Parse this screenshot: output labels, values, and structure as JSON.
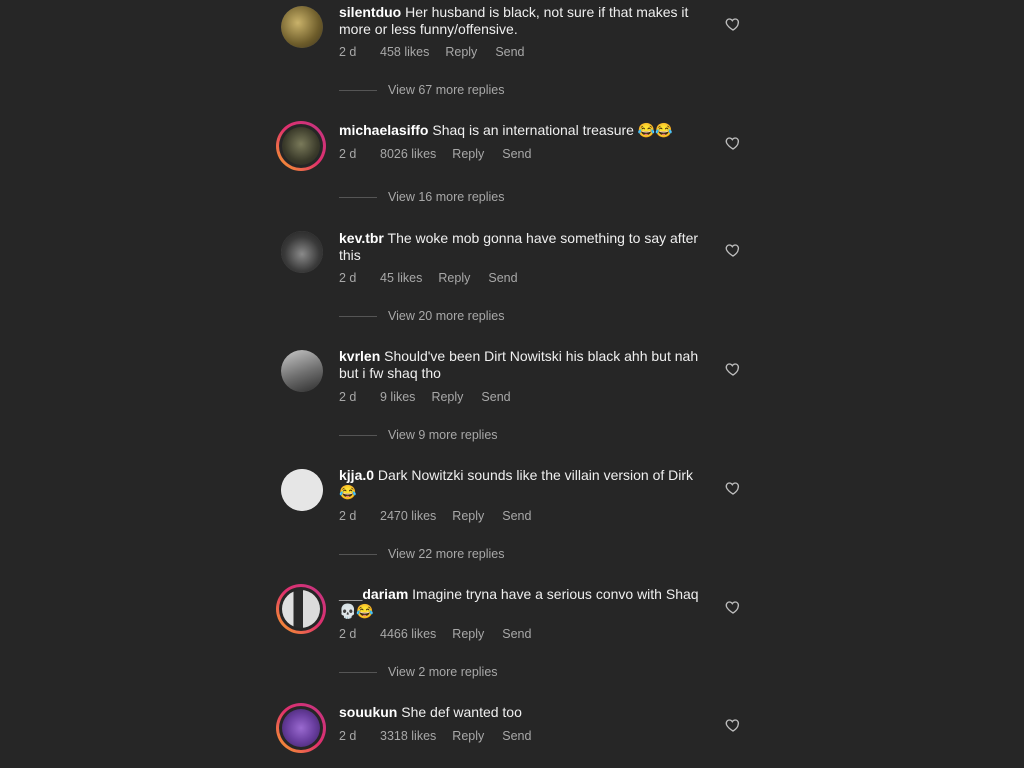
{
  "comments": [
    {
      "username": "silentduo",
      "text": "Her husband is black, not sure if that makes it more or less funny/offensive.",
      "time": "2 d",
      "likes": "458 likes",
      "reply": "Reply",
      "send": "Send",
      "view_replies": "View 67 more replies",
      "avatar_color": "#8a7a3a",
      "story_ring": false
    },
    {
      "username": "michaelasiffo",
      "text": "Shaq is an international treasure 😂😂",
      "time": "2 d",
      "likes": "8026 likes",
      "reply": "Reply",
      "send": "Send",
      "view_replies": "View 16 more replies",
      "avatar_color": "#4a4a36",
      "story_ring": true
    },
    {
      "username": "kev.tbr",
      "text": "The woke mob gonna have something to say after this",
      "time": "2 d",
      "likes": "45 likes",
      "reply": "Reply",
      "send": "Send",
      "view_replies": "View 20 more replies",
      "avatar_color": "#3c3c3c",
      "story_ring": false
    },
    {
      "username": "kvrlen",
      "text": "Should've been Dirt Nowitski his black ahh but nah but i fw shaq tho",
      "time": "2 d",
      "likes": "9 likes",
      "reply": "Reply",
      "send": "Send",
      "view_replies": "View 9 more replies",
      "avatar_color": "#6b6b6b",
      "story_ring": false
    },
    {
      "username": "kjja.0",
      "text": "Dark Nowitzki sounds like the villain version of Dirk 😂",
      "time": "2 d",
      "likes": "2470 likes",
      "reply": "Reply",
      "send": "Send",
      "view_replies": "View 22 more replies",
      "avatar_color": "#e6e6e6",
      "story_ring": false
    },
    {
      "username": "___dariam",
      "text": "Imagine tryna have a serious convo with Shaq 💀😂",
      "time": "2 d",
      "likes": "4466 likes",
      "reply": "Reply",
      "send": "Send",
      "view_replies": "View 2 more replies",
      "avatar_color": "#cfcfcf",
      "story_ring": true
    },
    {
      "username": "souukun",
      "text": "She def wanted too",
      "time": "2 d",
      "likes": "3318 likes",
      "reply": "Reply",
      "send": "Send",
      "avatar_color": "#6a3fa0",
      "story_ring": true
    }
  ],
  "icons": {
    "like": "heart-outline-icon"
  },
  "colors": {
    "background": "#262626",
    "secondary_text": "#a8a8a8",
    "story_ring": "#e1306c"
  }
}
